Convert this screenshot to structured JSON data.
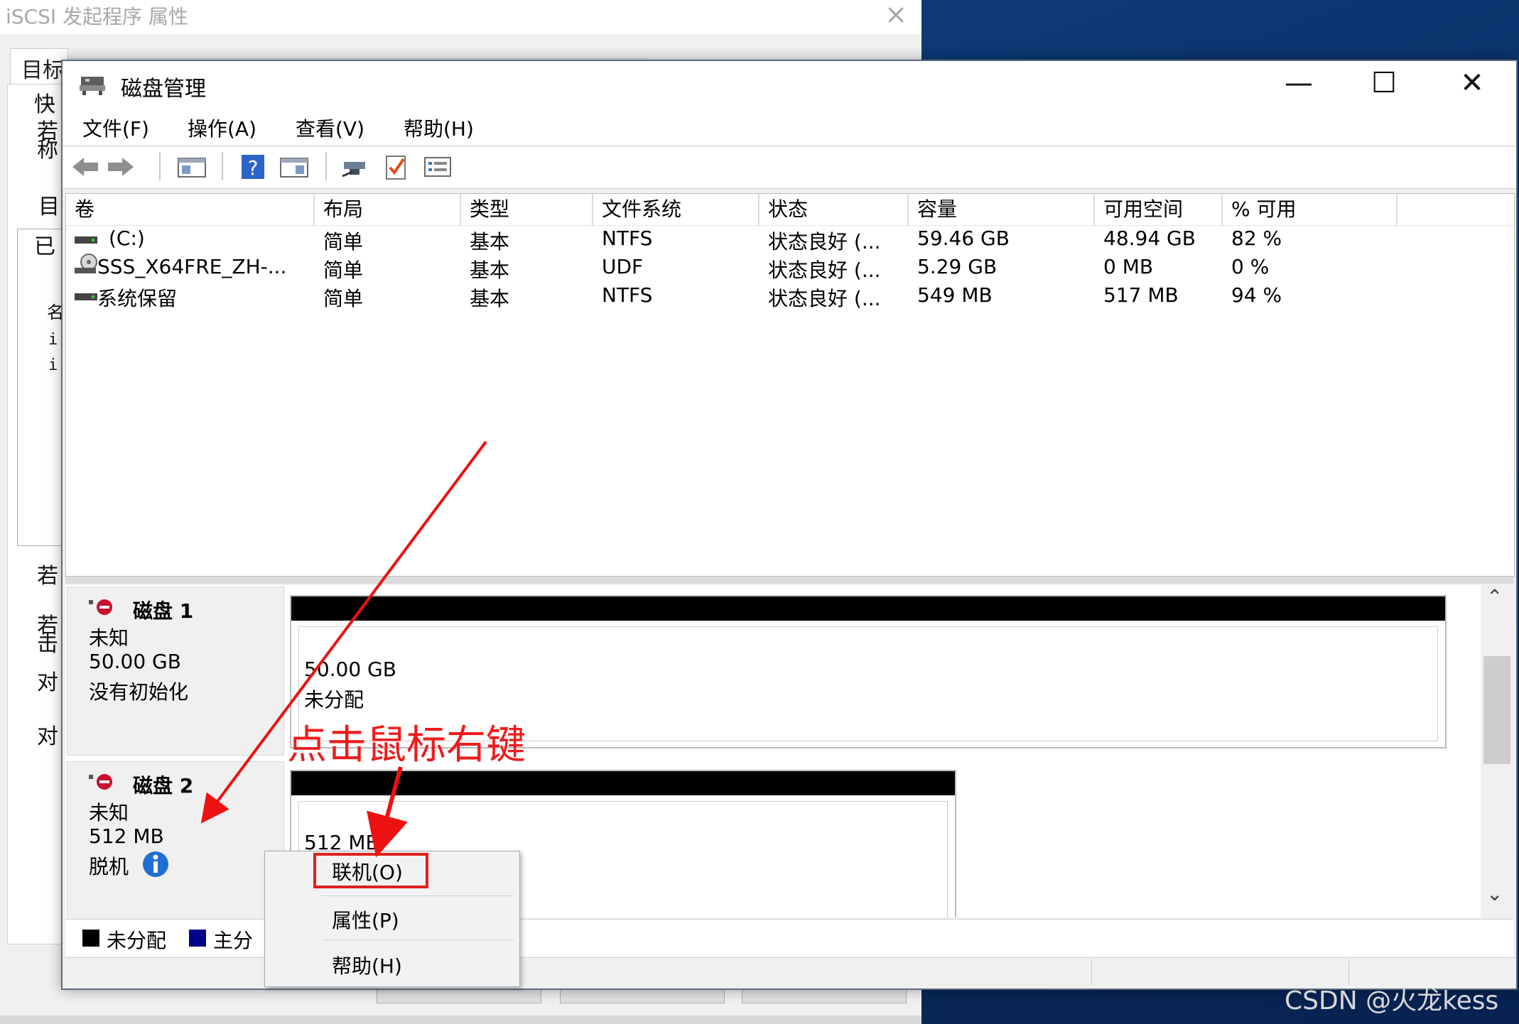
{
  "background_window": {
    "title": "iSCSI 发起程序 属性",
    "close_glyph": "×",
    "tab_label": "目标",
    "side_chars": [
      "快",
      "若",
      "称",
      "目",
      "已",
      "名",
      "i",
      "i",
      "若",
      "若",
      "击",
      "对",
      "对"
    ]
  },
  "window": {
    "title": "磁盘管理",
    "minimize_glyph": "—",
    "maximize_glyph": "☐",
    "close_glyph": "✕"
  },
  "menu": [
    "文件(F)",
    "操作(A)",
    "查看(V)",
    "帮助(H)"
  ],
  "toolbar_icons": [
    "back-arrow-icon",
    "forward-arrow-icon",
    "console-tree-icon",
    "help-icon",
    "properties-pane-icon",
    "connect-icon",
    "check-icon",
    "list-icon"
  ],
  "volumes": {
    "columns": [
      "卷",
      "布局",
      "类型",
      "文件系统",
      "状态",
      "容量",
      "可用空间",
      "% 可用"
    ],
    "rows": [
      {
        "volume": "(C:)",
        "layout": "简单",
        "type": "基本",
        "fs": "NTFS",
        "status": "状态良好 (...",
        "capacity": "59.46 GB",
        "free": "48.94 GB",
        "pct": "82 %",
        "icon": "drive-icon"
      },
      {
        "volume": "SSS_X64FRE_ZH-...",
        "layout": "简单",
        "type": "基本",
        "fs": "UDF",
        "status": "状态良好 (...",
        "capacity": "5.29 GB",
        "free": "0 MB",
        "pct": "0 %",
        "icon": "cd-drive-icon"
      },
      {
        "volume": "系统保留",
        "layout": "简单",
        "type": "基本",
        "fs": "NTFS",
        "status": "状态良好 (...",
        "capacity": "549 MB",
        "free": "517 MB",
        "pct": "94 %",
        "icon": "drive-icon"
      }
    ]
  },
  "disks": [
    {
      "name": "磁盘 1",
      "kind": "未知",
      "size": "50.00 GB",
      "state": "没有初始化",
      "part_size": "50.00 GB",
      "part_label": "未分配"
    },
    {
      "name": "磁盘 2",
      "kind": "未知",
      "size": "512 MB",
      "state": "脱机",
      "part_size": "512 MB"
    }
  ],
  "legend": [
    {
      "label": "未分配",
      "color": "#000000"
    },
    {
      "label": "主分",
      "color": "#00008b"
    }
  ],
  "context_menu": [
    "联机(O)",
    "属性(P)",
    "帮助(H)"
  ],
  "annotation": "点击鼠标右键",
  "watermark": "CSDN @火龙kess",
  "scroll_glyphs": {
    "up": "⌃",
    "down": "⌄"
  }
}
